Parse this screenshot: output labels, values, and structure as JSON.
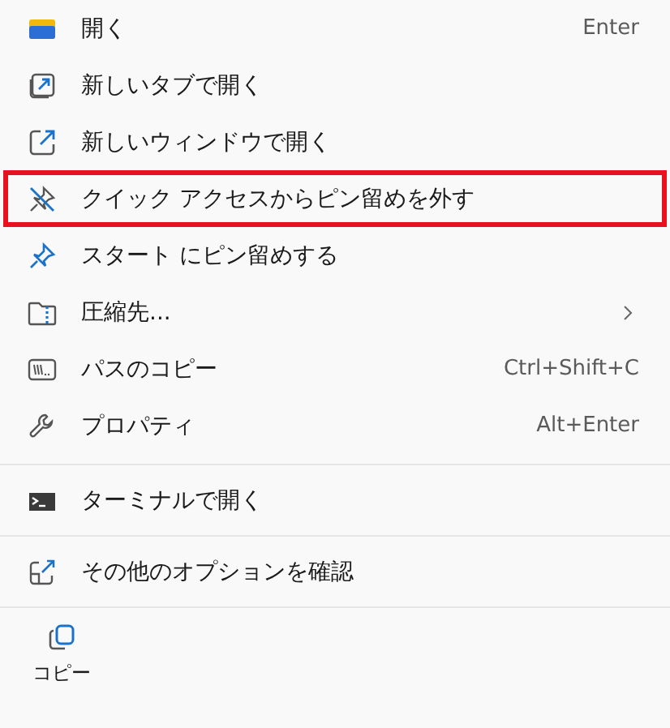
{
  "menu": {
    "groups": [
      {
        "items": [
          {
            "label": "開く",
            "shortcut": "Enter",
            "highlighted": false,
            "submenu": false
          },
          {
            "label": "新しいタブで開く",
            "highlighted": false,
            "submenu": false
          },
          {
            "label": "新しいウィンドウで開く",
            "highlighted": false,
            "submenu": false
          },
          {
            "label": "クイック アクセスからピン留めを外す",
            "highlighted": true,
            "submenu": false
          },
          {
            "label": "スタート にピン留めする",
            "highlighted": false,
            "submenu": false
          },
          {
            "label": "圧縮先...",
            "highlighted": false,
            "submenu": true
          },
          {
            "label": "パスのコピー",
            "shortcut": "Ctrl+Shift+C",
            "highlighted": false,
            "submenu": false
          },
          {
            "label": "プロパティ",
            "shortcut": "Alt+Enter",
            "highlighted": false,
            "submenu": false
          }
        ]
      },
      {
        "items": [
          {
            "label": "ターミナルで開く",
            "highlighted": false,
            "submenu": false
          }
        ]
      },
      {
        "items": [
          {
            "label": "その他のオプションを確認",
            "highlighted": false,
            "submenu": false
          }
        ]
      }
    ],
    "toolbar": [
      {
        "label": "コピー"
      }
    ]
  }
}
